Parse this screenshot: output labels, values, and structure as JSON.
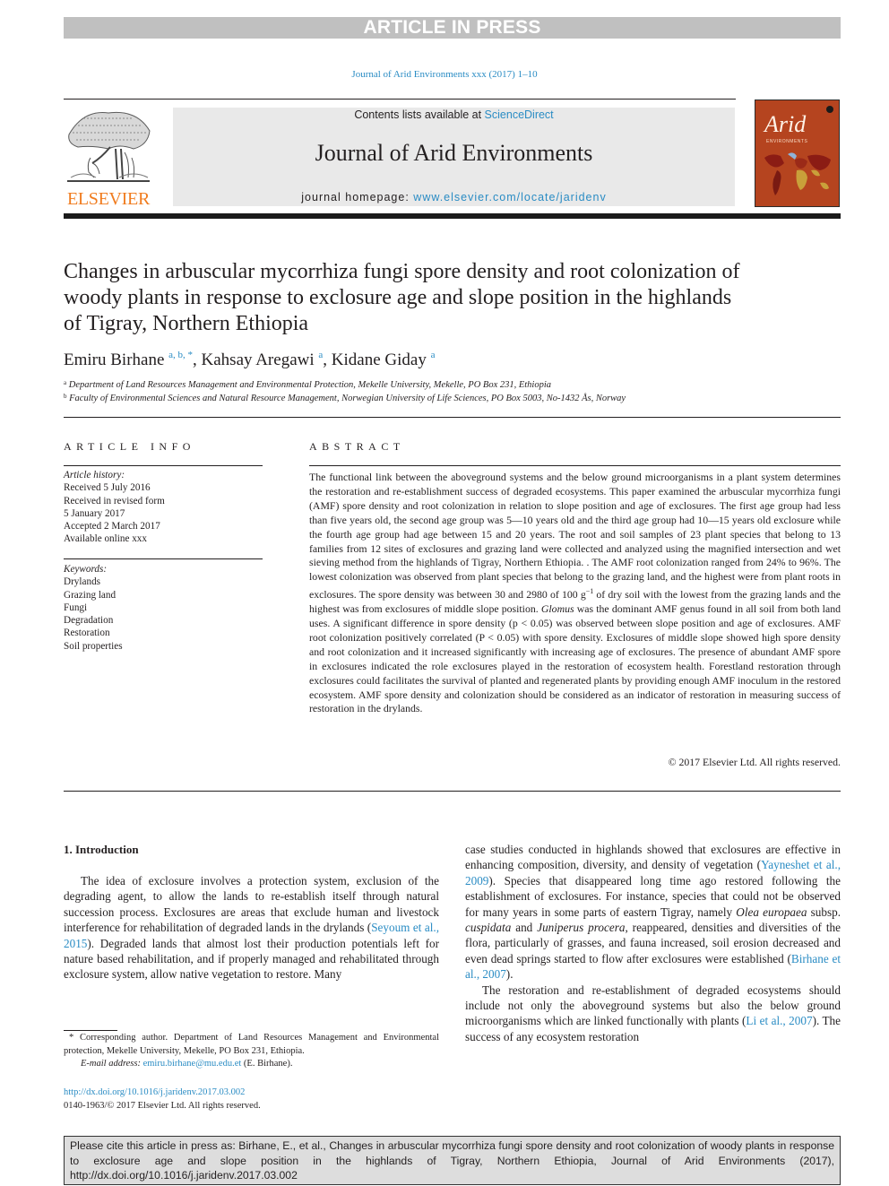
{
  "banner": {
    "text": "ARTICLE IN PRESS"
  },
  "journal_ref": "Journal of Arid Environments xxx (2017) 1–10",
  "masthead": {
    "publisher_logo": "ELSEVIER",
    "contents_prefix": "Contents lists available at ",
    "contents_link": "ScienceDirect",
    "journal_title": "Journal of Arid Environments",
    "homepage_prefix": "journal homepage: ",
    "homepage_link": "www.elsevier.com/locate/jaridenv",
    "cover_title": "Arid",
    "cover_subtitle": "ENVIRONMENTS"
  },
  "article": {
    "title": "Changes in arbuscular mycorrhiza fungi spore density and root colonization of woody plants in response to exclosure age and slope position in the highlands of Tigray, Northern Ethiopia",
    "authors": [
      {
        "name": "Emiru Birhane",
        "sup": "a, b, *"
      },
      {
        "name": "Kahsay Aregawi",
        "sup": "a"
      },
      {
        "name": "Kidane Giday",
        "sup": "a"
      }
    ],
    "affiliations": [
      {
        "mark": "a",
        "text": "Department of Land Resources Management and Environmental Protection, Mekelle University, Mekelle, PO Box 231, Ethiopia"
      },
      {
        "mark": "b",
        "text": "Faculty of Environmental Sciences and Natural Resource Management, Norwegian University of Life Sciences, PO Box 5003, No-1432 Ås, Norway"
      }
    ]
  },
  "article_info": {
    "heading": "ARTICLE INFO",
    "history_label": "Article history:",
    "history": [
      "Received 5 July 2016",
      "Received in revised form",
      "5 January 2017",
      "Accepted 2 March 2017",
      "Available online xxx"
    ],
    "keywords_label": "Keywords:",
    "keywords": [
      "Drylands",
      "Grazing land",
      "Fungi",
      "Degradation",
      "Restoration",
      "Soil properties"
    ]
  },
  "abstract": {
    "heading": "ABSTRACT",
    "part1": "The functional link between the aboveground systems and the below ground microorganisms in a plant system determines the restoration and re-establishment success of degraded ecosystems. This paper examined the arbuscular mycorrhiza fungi (AMF) spore density and root colonization in relation to slope position and age of exclosures. The first age group had less than five years old, the second age group was 5—10 years old and the third age group had 10—15 years old exclosure while the fourth age group had age between 15 and 20 years. The root and soil samples of 23 plant species that belong to 13 families from 12 sites of exclosures and grazing land were collected and analyzed using the magnified intersection and wet sieving method from the highlands of Tigray, Northern Ethiopia. . The AMF root colonization ranged from 24% to 96%. The lowest colonization was observed from plant species that belong to the grazing land, and the highest were from plant roots in exclosures. The spore density was between 30 and 2980 of 100 g",
    "exponent": "−1",
    "part2": " of dry soil with the lowest from the grazing lands and the highest was from exclosures of middle slope position. ",
    "genus": "Glomus",
    "part3": " was the dominant AMF genus found in all soil from both land uses. A significant difference in spore density (p < 0.05) was observed between slope position and age of exclosures. AMF root colonization positively correlated (P < 0.05) with spore density. Exclosures of middle slope showed high spore density and root colonization and it increased significantly with increasing age of exclosures. The presence of abundant AMF spore in exclosures indicated the role exclosures played in the restoration of ecosystem health. Forestland restoration through exclosures could facilitates the survival of planted and regenerated plants by providing enough AMF inoculum in the restored ecosystem. AMF spore density and colonization should be considered as an indicator of restoration in measuring success of restoration in the drylands.",
    "copyright": "© 2017 Elsevier Ltd. All rights reserved."
  },
  "introduction": {
    "heading": "1.  Introduction",
    "left_p1_a": "The idea of exclosure involves a protection system, exclusion of the degrading agent, to allow the lands to re-establish itself through natural succession process. Exclosures are areas that exclude human and livestock interference for rehabilitation of degraded lands in the drylands (",
    "cite1": "Seyoum et al., 2015",
    "left_p1_b": "). Degraded lands that almost lost their production potentials left for nature based rehabilitation, and if properly managed and rehabilitated through exclosure system, allow native vegetation to restore. Many",
    "right_p1_a": "case studies conducted in highlands showed that exclosures are effective in enhancing composition, diversity, and density of vegetation (",
    "cite2": "Yayneshet et al., 2009",
    "right_p1_b": "). Species that disappeared long time ago restored following the establishment of exclosures. For instance, species that could not be observed for many years in some parts of eastern Tigray, namely ",
    "species1": "Olea europaea",
    "right_p1_c": " subsp. ",
    "species1_sub": "cuspidata",
    "right_p1_d": " and ",
    "species2": "Juniperus procera",
    "right_p1_e": ", reappeared, densities and diversities of the flora, particularly of grasses, and fauna increased, soil erosion decreased and even dead springs started to flow after exclosures were established (",
    "cite3": "Birhane et al., 2007",
    "right_p1_f": ").",
    "right_p2_a": "The restoration and re-establishment of degraded ecosystems should include not only the aboveground systems but also the below ground microorganisms which are linked functionally with plants (",
    "cite4": "Li et al., 2007",
    "right_p2_b": "). The success of any ecosystem restoration"
  },
  "footnote": {
    "corresponding": "* Corresponding author. Department of Land Resources Management and Environmental protection, Mekelle University, Mekelle, PO Box 231, Ethiopia.",
    "email_label": "E-mail address: ",
    "email": "emiru.birhane@mu.edu.et",
    "email_suffix": " (E. Birhane)."
  },
  "doi": {
    "link": "http://dx.doi.org/10.1016/j.jaridenv.2017.03.002",
    "issn_line": "0140-1963/© 2017 Elsevier Ltd. All rights reserved."
  },
  "citation_box": {
    "text": "Please cite this article in press as: Birhane, E., et al., Changes in arbuscular mycorrhiza fungi spore density and root colonization of woody plants in response to exclosure age and slope position in the highlands of Tigray, Northern Ethiopia, Journal of Arid Environments (2017), http://dx.doi.org/10.1016/j.jaridenv.2017.03.002"
  },
  "colors": {
    "link": "#2a8cc4",
    "elsevier_orange": "#f07c1f",
    "banner_gray": "#c0c0c0",
    "cover_red": "#b5441f"
  }
}
